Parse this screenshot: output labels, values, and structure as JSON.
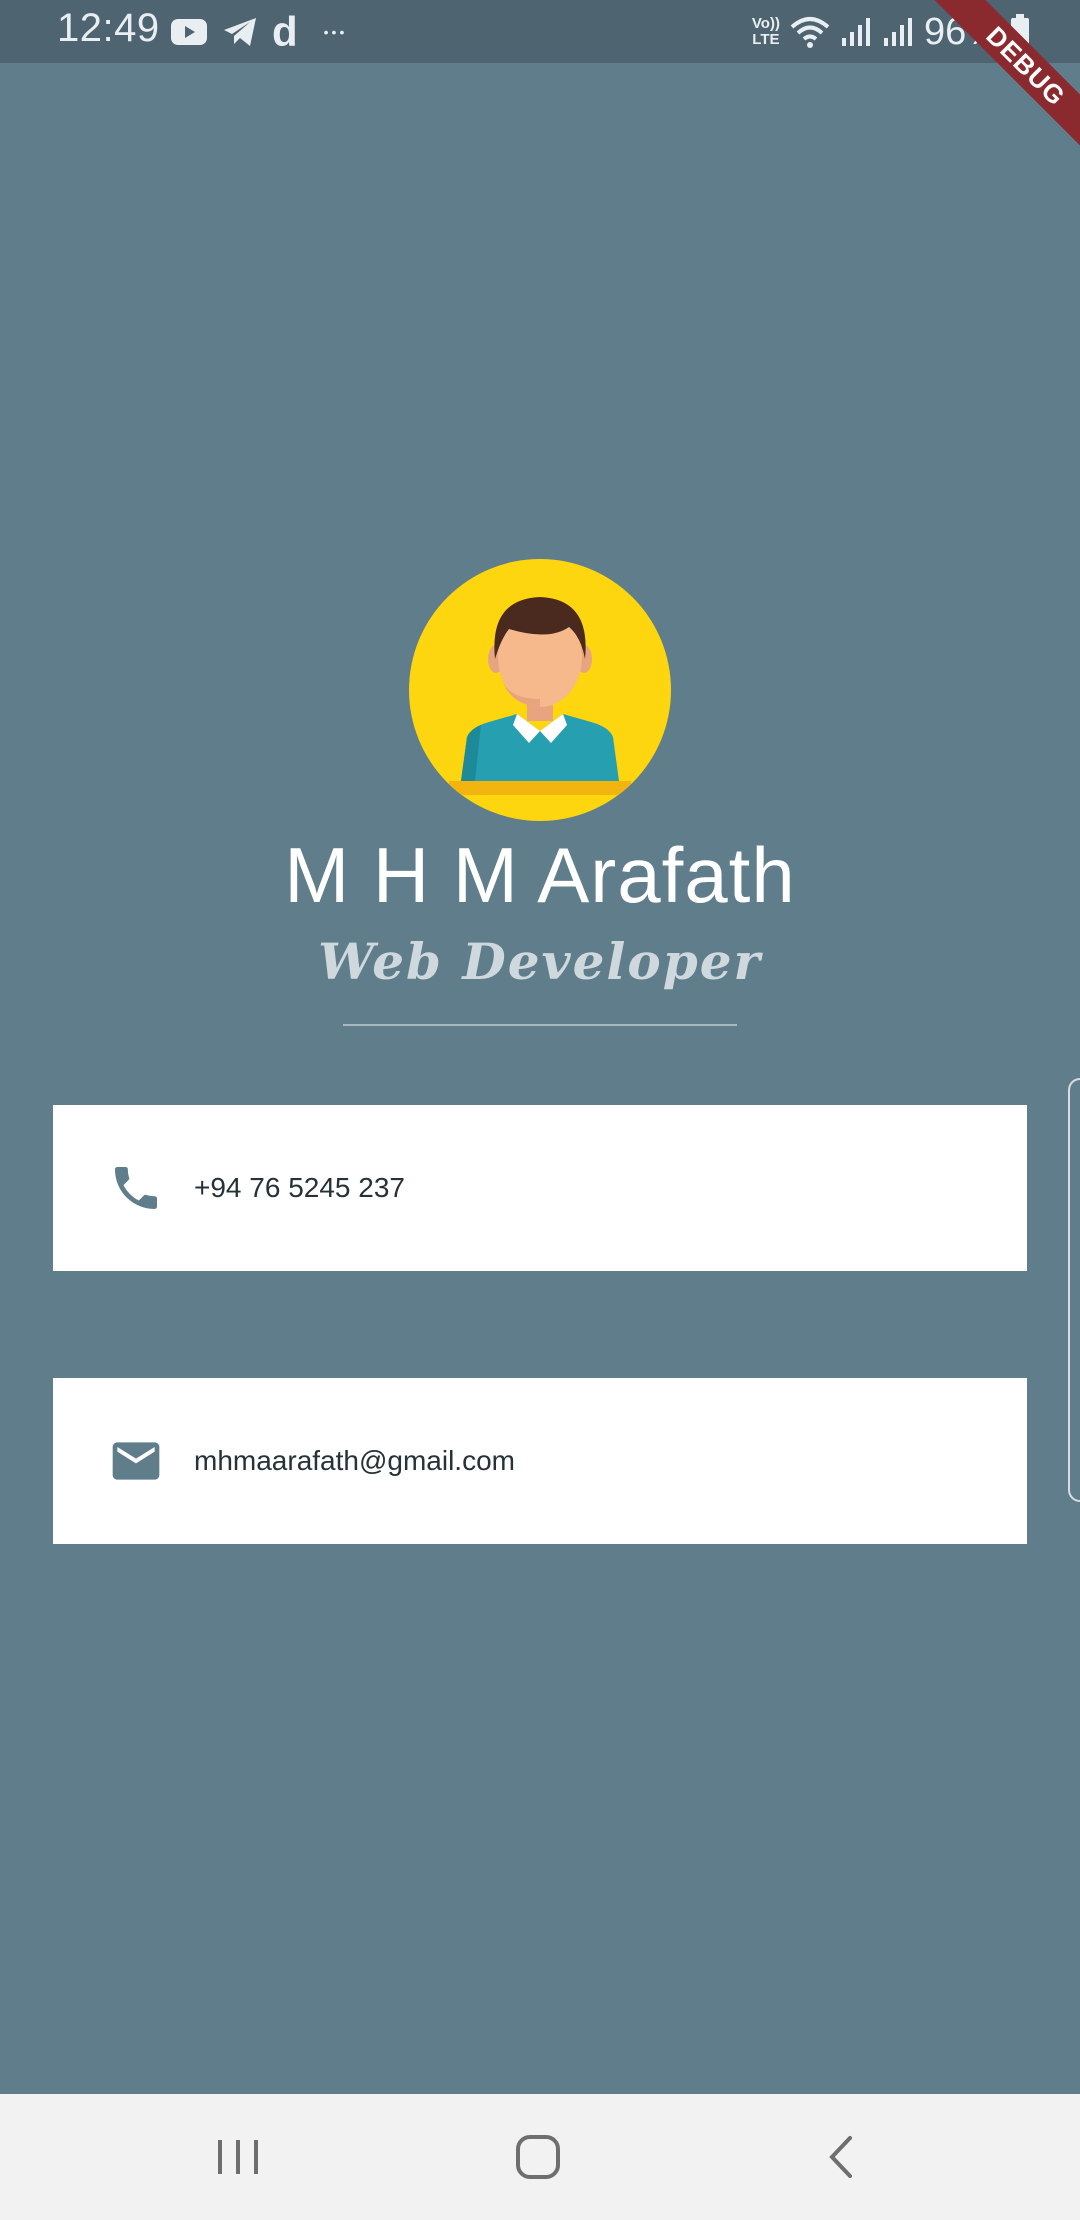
{
  "status_bar": {
    "time": "12:49",
    "battery": "96%",
    "volte_line1": "Vo))",
    "volte_line2": "LTE",
    "app_icons": [
      "youtube-icon",
      "telegram-icon",
      "d-app-icon",
      "more-dots-icon"
    ],
    "d_app_glyph": "d",
    "more_glyph": "•••"
  },
  "debug_banner": {
    "label": "DEBUG",
    "color": "#8B2A2E"
  },
  "profile": {
    "name": "M H M Arafath",
    "title": "Web Developer",
    "avatar_bg": "#FDD60F"
  },
  "contacts": [
    {
      "icon": "phone-icon",
      "value": "+94 76 5245 237"
    },
    {
      "icon": "email-icon",
      "value": "mhmaarafath@gmail.com"
    }
  ],
  "theme": {
    "background": "#607D8B",
    "card": "#FFFFFF",
    "icon_color": "#607D8B"
  },
  "nav_bar": {
    "buttons": [
      "recents-button",
      "home-button",
      "back-button"
    ]
  }
}
